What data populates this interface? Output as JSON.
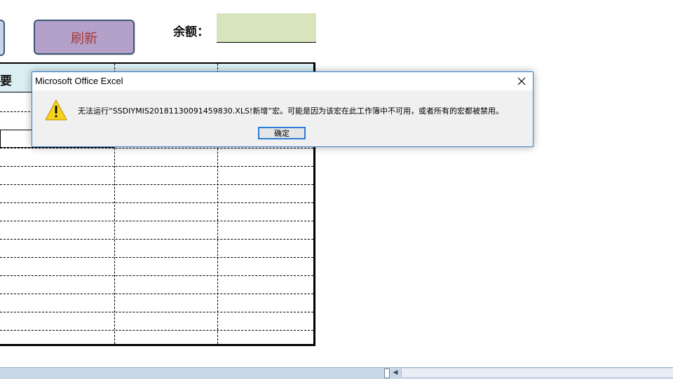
{
  "sheet": {
    "refresh_label": "刷新",
    "balance_label": "余额：",
    "header_partial": "要",
    "colors": {
      "refresh_bg": "#b4a1c9",
      "refresh_text": "#a83a3a",
      "balance_cell": "#d7e4bc",
      "header_bg": "#daeef3"
    }
  },
  "dialog": {
    "title": "Microsoft Office Excel",
    "message": "无法运行“SSDIYMIS20181130091459830.XLS!新增”宏。可能是因为该宏在此工作簿中不可用，或者所有的宏都被禁用。",
    "ok_label": "确定",
    "icon": "warning-icon",
    "close_icon": "close-icon"
  }
}
